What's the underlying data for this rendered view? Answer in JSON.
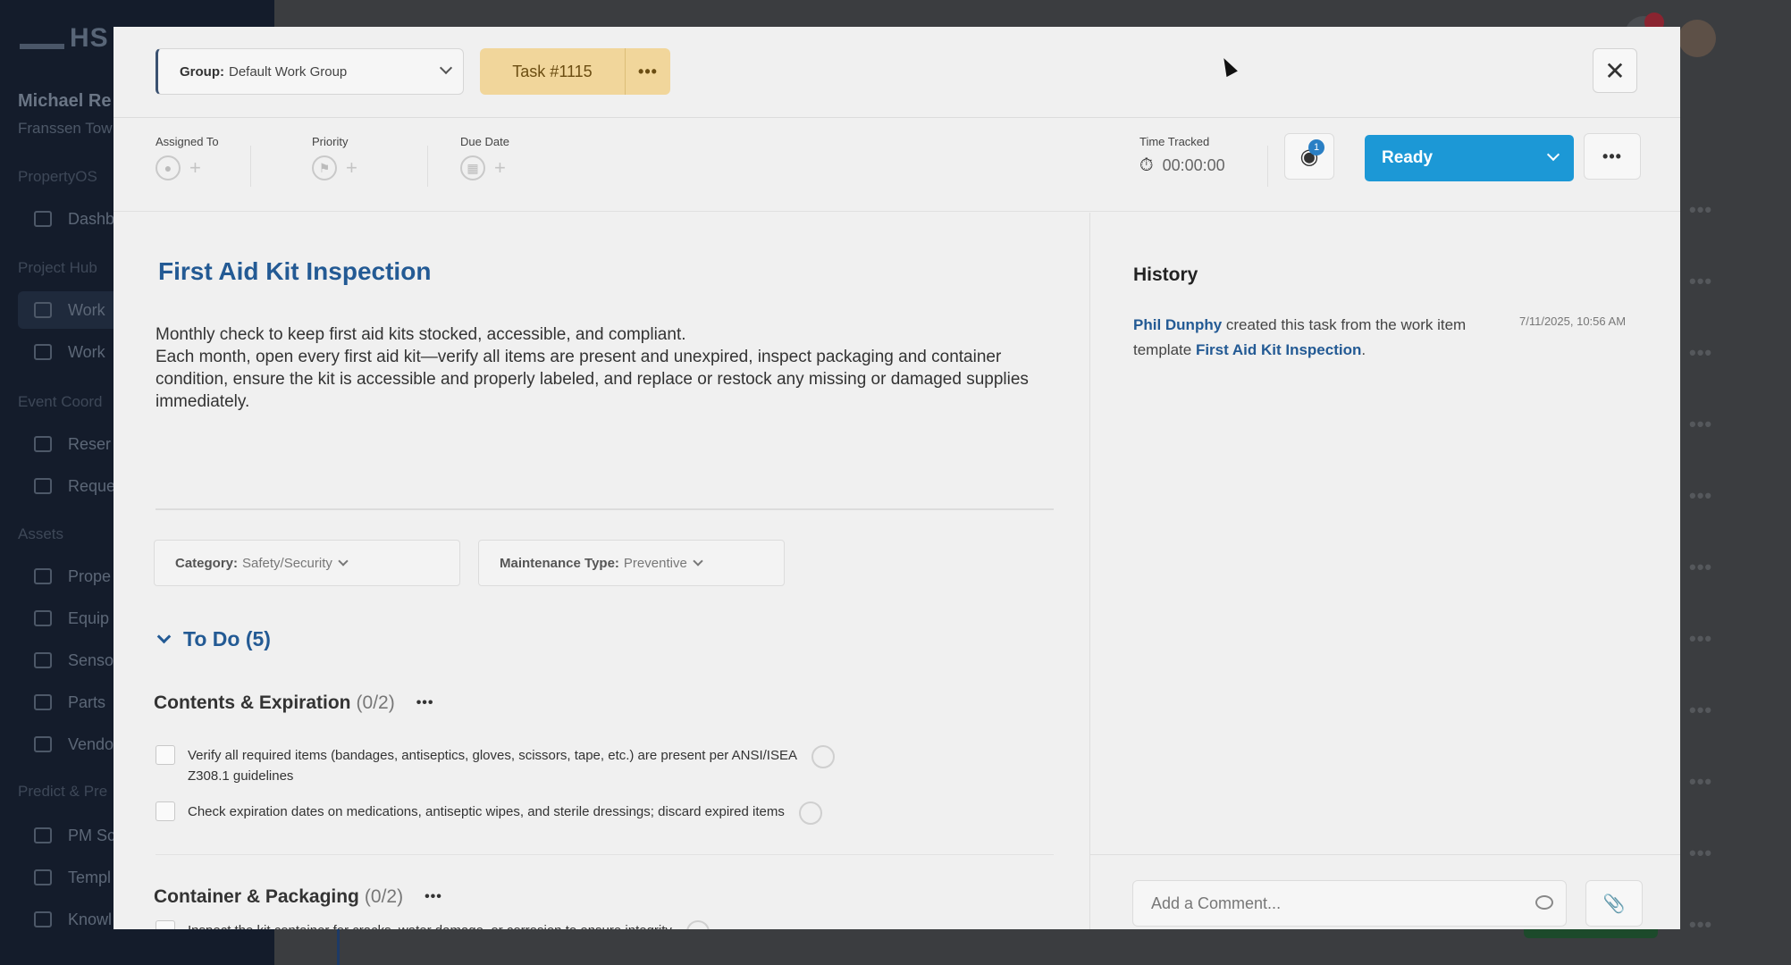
{
  "background": {
    "logo_text": "HS",
    "user_name": "Michael Re",
    "user_sub": "Franssen Tow",
    "sections": [
      "PropertyOS",
      "Project Hub",
      "Event Coord",
      "Assets",
      "Predict & Pre"
    ],
    "items": [
      "Dashb",
      "Work",
      "Work",
      "Reser",
      "Reque",
      "Prope",
      "Equip",
      "Senso",
      "Parts",
      "Vendo",
      "PM Sc",
      "Templ",
      "Knowl"
    ],
    "row_dots": "•••"
  },
  "header": {
    "group_label": "Group:",
    "group_value": "Default Work Group",
    "task_number": "Task #1115",
    "task_more": "•••",
    "close_symbol": "✕"
  },
  "meta": {
    "assigned_to_label": "Assigned To",
    "priority_label": "Priority",
    "due_date_label": "Due Date",
    "add_symbol": "+",
    "time_tracked_label": "Time Tracked",
    "time_tracked_value": "00:00:00",
    "watch_count": "1",
    "status_label": "Ready",
    "more_symbol": "•••"
  },
  "task": {
    "title": "First Aid Kit Inspection",
    "description_line1": "Monthly check to keep first aid kits stocked, accessible, and compliant.",
    "description_line2": "Each month, open every first aid kit—verify all items are present and unexpired, inspect packaging and container condition, ensure the kit is accessible and properly labeled, and replace or restock any missing or damaged supplies immediately.",
    "category_label": "Category:",
    "category_value": "Safety/Security",
    "maintenance_label": "Maintenance Type:",
    "maintenance_value": "Preventive"
  },
  "todo": {
    "heading": "To Do (5)",
    "groups": [
      {
        "name": "Contents & Expiration",
        "count": "(0/2)",
        "items": [
          "Verify all required items (bandages, antiseptics, gloves, scissors, tape, etc.) are present per ANSI/ISEA Z308.1 guidelines",
          "Check expiration dates on medications, antiseptic wipes, and sterile dressings; discard expired items"
        ]
      },
      {
        "name": "Container & Packaging",
        "count": "(0/2)",
        "items": [
          "Inspect the kit container for cracks, water damage, or corrosion to ensure integrity"
        ]
      }
    ],
    "group_more": "•••"
  },
  "history": {
    "title": "History",
    "entry_user": "Phil Dunphy",
    "entry_text": " created this task from the work item template ",
    "entry_link": "First Aid Kit Inspection",
    "entry_end": ".",
    "entry_time": "7/11/2025, 10:56 AM"
  },
  "comment": {
    "placeholder": "Add a Comment..."
  },
  "icons": {
    "close": "x-icon",
    "watch": "eye-icon",
    "stopwatch": "stopwatch-icon",
    "attach": "paperclip-icon",
    "comment": "chat-bubble-icon"
  },
  "colors": {
    "accent": "#235a94",
    "status_button": "#1c98d6",
    "task_chip": "#f1d69b"
  }
}
